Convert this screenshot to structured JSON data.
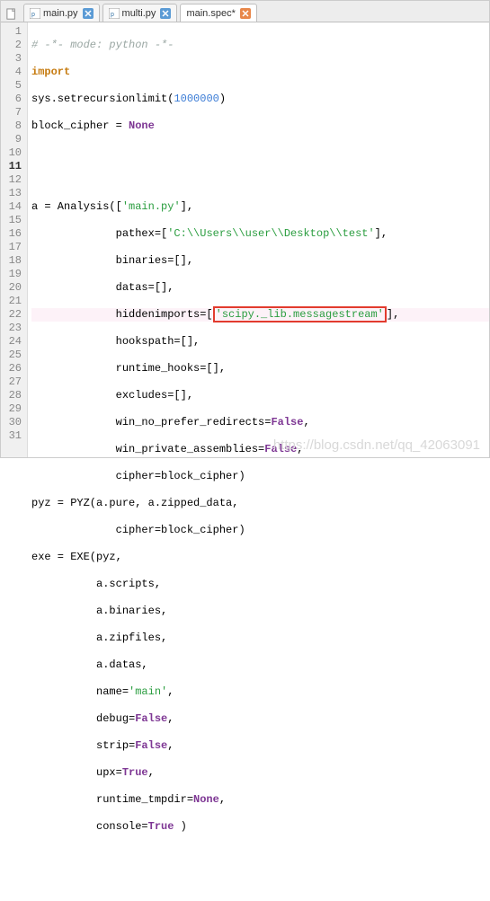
{
  "tabs": [
    {
      "label": "main.py",
      "active": false,
      "close_style": "blue"
    },
    {
      "label": "multi.py",
      "active": false,
      "close_style": "blue"
    },
    {
      "label": "main.spec*",
      "active": true,
      "close_style": "orange"
    }
  ],
  "highlighted_line": 11,
  "lines": {
    "l1": "# -*- mode: python -*-",
    "l2_kw": "import",
    "l3a": "sys.setrecursionlimit(",
    "l3_num": "1000000",
    "l3b": ")",
    "l4a": "block_cipher = ",
    "l4_const": "None",
    "l7a": "a = Analysis([",
    "l7_str": "'main.py'",
    "l7b": "],",
    "l8a": "             pathex=[",
    "l8_str": "'C:\\\\Users\\\\user\\\\Desktop\\\\test'",
    "l8b": "],",
    "l9": "             binaries=[],",
    "l10": "             datas=[],",
    "l11a": "             hiddenimports=[",
    "l11_str": "'scipy._lib.messagestream'",
    "l11b": "],",
    "l12": "             hookspath=[],",
    "l13": "             runtime_hooks=[],",
    "l14": "             excludes=[],",
    "l15a": "             win_no_prefer_redirects=",
    "l15_const": "False",
    "l15b": ",",
    "l16a": "             win_private_assemblies=",
    "l16_const": "False",
    "l16b": ",",
    "l17": "             cipher=block_cipher)",
    "l18": "pyz = PYZ(a.pure, a.zipped_data,",
    "l19": "             cipher=block_cipher)",
    "l20": "exe = EXE(pyz,",
    "l21": "          a.scripts,",
    "l22": "          a.binaries,",
    "l23": "          a.zipfiles,",
    "l24": "          a.datas,",
    "l25a": "          name=",
    "l25_str": "'main'",
    "l25b": ",",
    "l26a": "          debug=",
    "l26_const": "False",
    "l26b": ",",
    "l27a": "          strip=",
    "l27_const": "False",
    "l27b": ",",
    "l28a": "          upx=",
    "l28_const": "True",
    "l28b": ",",
    "l29a": "          runtime_tmpdir=",
    "l29_const": "None",
    "l29b": ",",
    "l30a": "          console=",
    "l30_const": "True",
    "l30b": " )"
  },
  "watermark": "https://blog.csdn.net/qq_42063091"
}
